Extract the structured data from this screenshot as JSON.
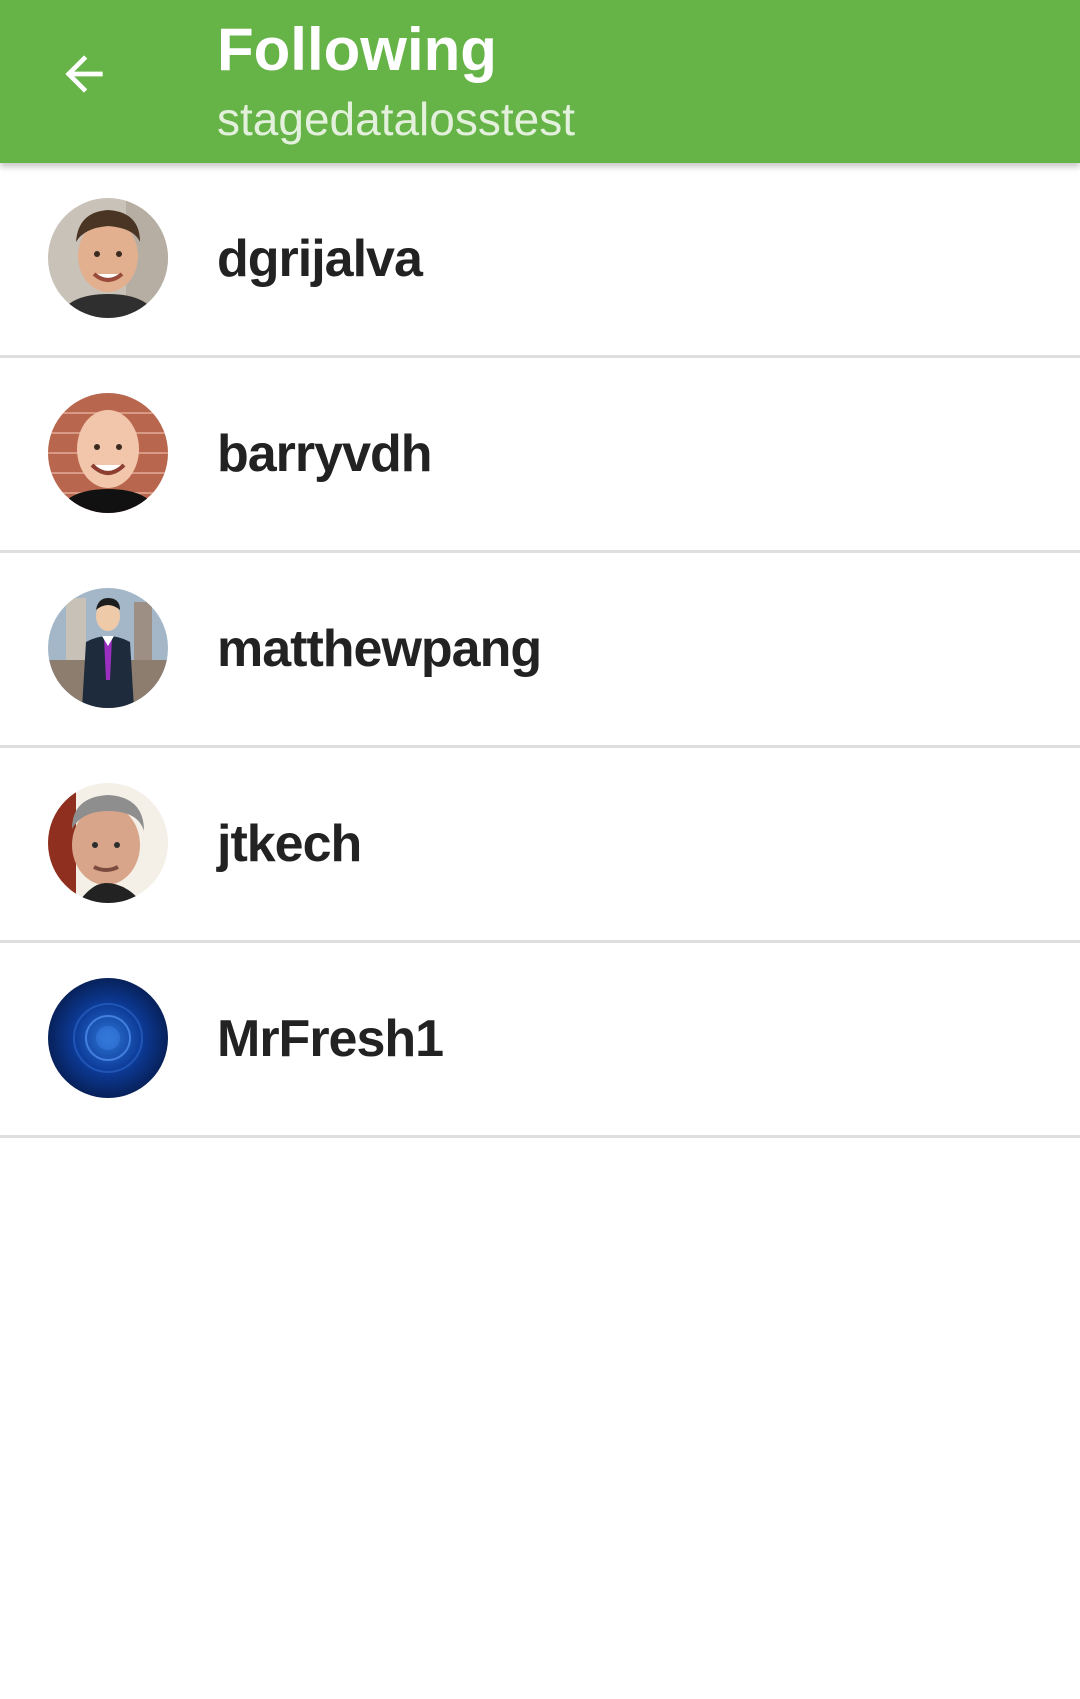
{
  "toolbar": {
    "title": "Following",
    "subtitle": "stagedatalosstest",
    "back_icon": "arrow-left-icon",
    "background_color": "#66b347"
  },
  "following": [
    {
      "username": "dgrijalva",
      "avatar_icon": "avatar-photo-man-short-brown-hair"
    },
    {
      "username": "barryvdh",
      "avatar_icon": "avatar-photo-bald-man-brick-wall"
    },
    {
      "username": "matthewpang",
      "avatar_icon": "avatar-photo-man-suit-purple-tie"
    },
    {
      "username": "jtkech",
      "avatar_icon": "avatar-photo-older-man-gray-hair"
    },
    {
      "username": "MrFresh1",
      "avatar_icon": "avatar-blue-abstract-circle"
    }
  ]
}
